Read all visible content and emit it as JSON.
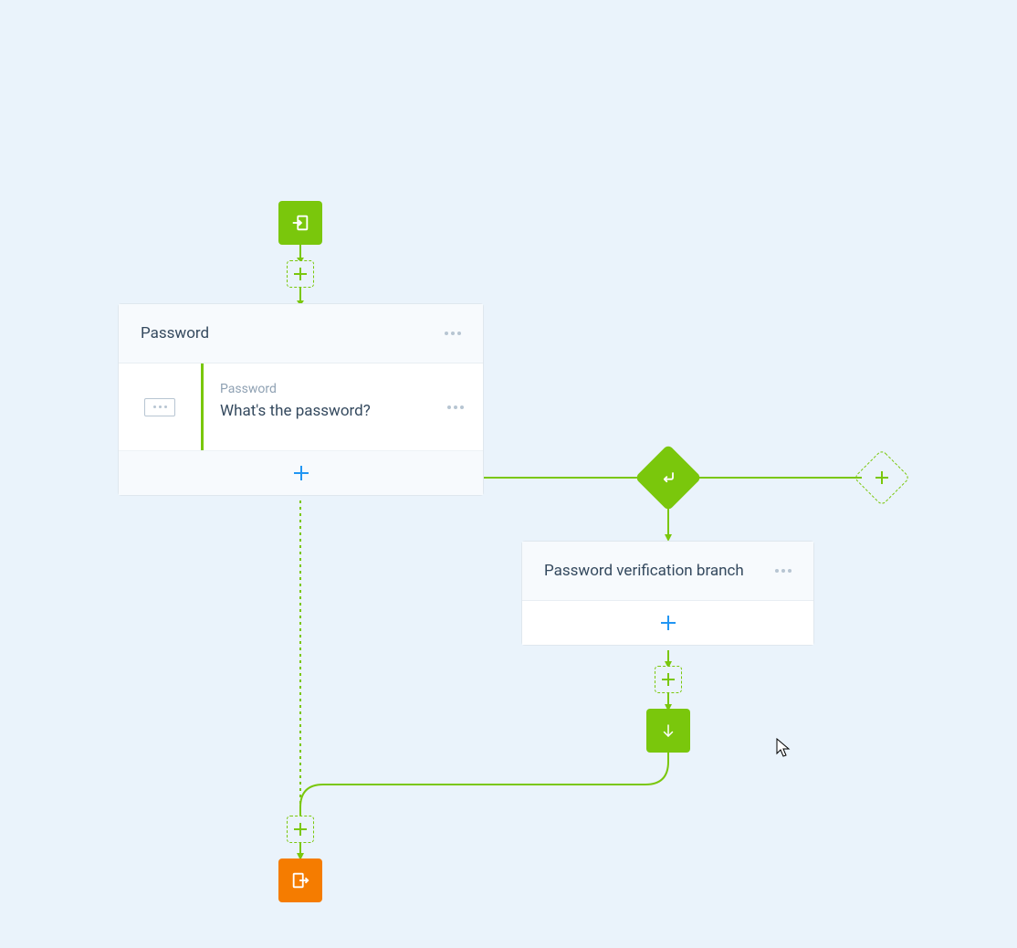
{
  "colors": {
    "green": "#7AC70C",
    "orange": "#F57C00",
    "blue": "#2196F3",
    "bg": "#EAF3FB"
  },
  "nodes": {
    "start": {
      "icon": "enter-icon"
    },
    "end": {
      "icon": "exit-icon"
    },
    "continue": {
      "icon": "arrow-down-icon"
    },
    "decision": {
      "icon": "return-icon"
    }
  },
  "card1": {
    "title": "Password",
    "row": {
      "kicker": "Password",
      "title": "What's the password?"
    }
  },
  "card2": {
    "title": "Password verification branch"
  }
}
